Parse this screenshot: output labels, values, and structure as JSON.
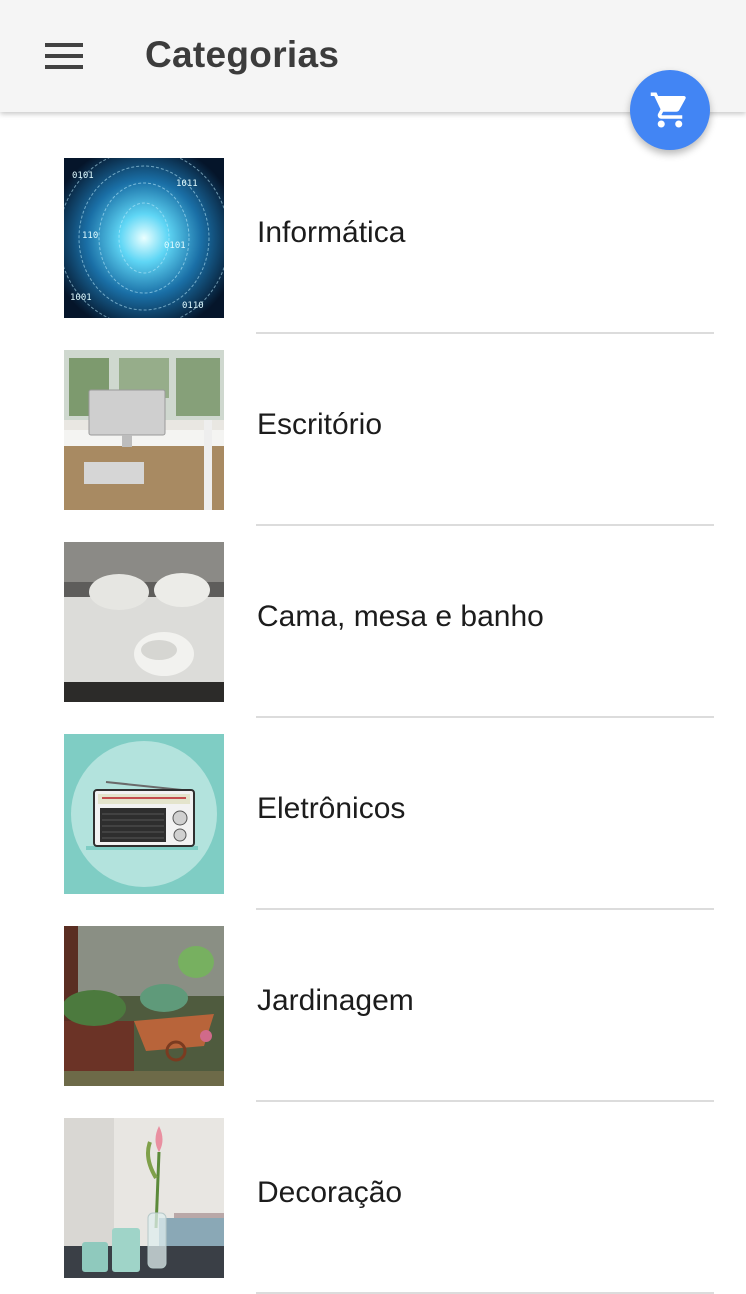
{
  "appbar": {
    "title": "Categorias",
    "menu_icon": "menu-icon",
    "cart_icon": "shopping-cart-icon",
    "accent_color": "#4285f4"
  },
  "categories": [
    {
      "label": "Informática",
      "image": "binary-tunnel-image"
    },
    {
      "label": "Escritório",
      "image": "office-desk-image"
    },
    {
      "label": "Cama, mesa e banho",
      "image": "bed-pillows-image"
    },
    {
      "label": "Eletrônicos",
      "image": "radio-illustration-image"
    },
    {
      "label": "Jardinagem",
      "image": "wheelbarrow-garden-image"
    },
    {
      "label": "Decoração",
      "image": "tulip-vase-image"
    }
  ]
}
